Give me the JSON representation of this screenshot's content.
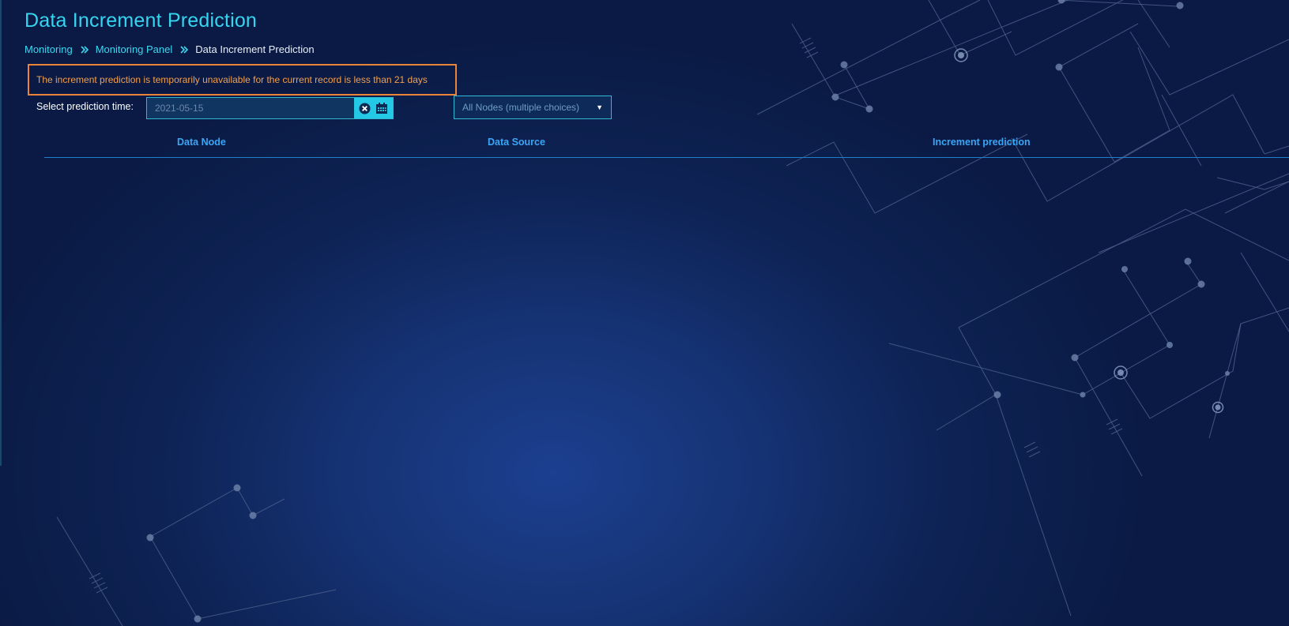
{
  "header": {
    "title": "Data Increment Prediction"
  },
  "breadcrumb": {
    "items": [
      "Monitoring",
      "Monitoring Panel"
    ],
    "current": "Data Increment Prediction"
  },
  "notice": {
    "text": "The increment prediction is temporarily unavailable for the current record is less than 21 days"
  },
  "filters": {
    "time_label": "Select prediction time:",
    "date_value": "2021-05-15",
    "node_select_value": "All Nodes (multiple choices)"
  },
  "table": {
    "columns": [
      "Data Node",
      "Data Source",
      "Increment prediction"
    ],
    "rows": []
  },
  "colors": {
    "title": "#35d5f0",
    "accent": "#24c9e6",
    "warning": "#e9843a",
    "table_header": "#3aa6f6"
  }
}
